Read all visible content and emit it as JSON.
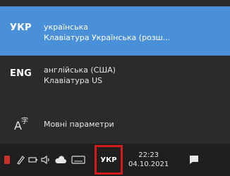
{
  "languages": [
    {
      "code": "УКР",
      "name": "українська",
      "keyboard": "Клавіатура Українська (розш...",
      "selected": true
    },
    {
      "code": "ENG",
      "name": "англійська (США)",
      "keyboard": "Клавіатура US",
      "selected": false
    }
  ],
  "settings": {
    "label": "Мовні параметри",
    "icon": "language-settings-icon"
  },
  "taskbar": {
    "language_indicator": "УКР",
    "time": "22:23",
    "date": "04.10.2021",
    "tray_icons": [
      "red-app-icon",
      "pen-icon",
      "battery-icon",
      "speaker-icon",
      "cloud-icon",
      "keyboard-icon"
    ],
    "notification_icon": "notification-icon"
  },
  "colors": {
    "selected_bg": "#4a90d9",
    "flyout_bg": "#2b2b2b",
    "taskbar_bg": "#1f1f1f",
    "highlight_border": "#d21b1b"
  }
}
